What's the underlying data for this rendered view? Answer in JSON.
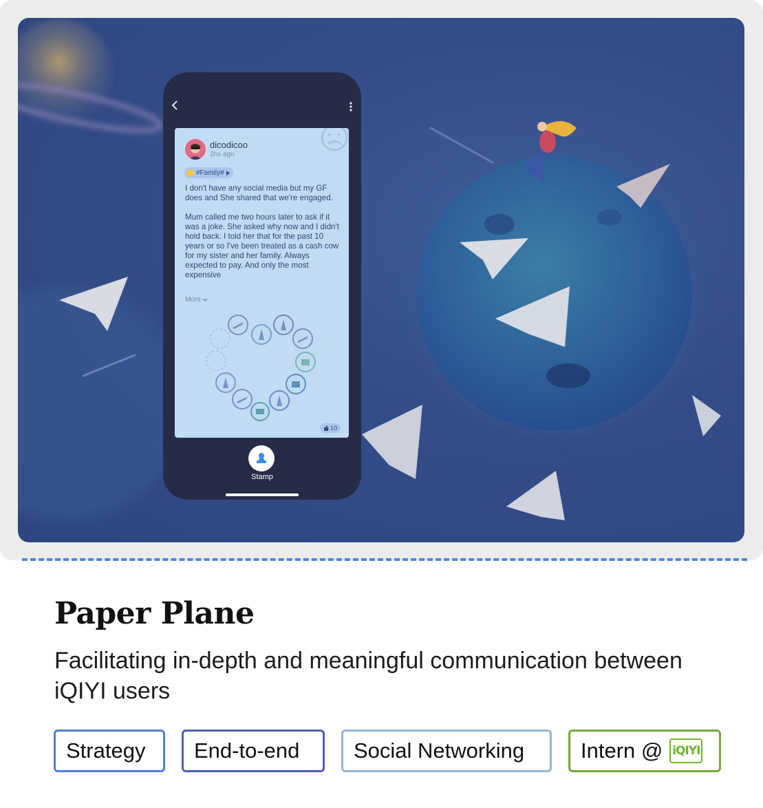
{
  "hero": {
    "post": {
      "username": "dicodicoo",
      "time": "2hs ago",
      "tag": "#Family#",
      "body": "I don't have any social media but my GF does and She shared that we're engaged.\n\nMum called me two hours later to ask if it was a joke. She asked why now and I didn't hold back. I told her that for the past 10 years or so I've been treated as a cash cow for my sister and her family. Always expected to pay. And only the most expensive",
      "more_label": "More",
      "likes": "10"
    },
    "stamp_label": "Stamp"
  },
  "project": {
    "title": "Paper Plane",
    "subtitle": "Facilitating in-depth and meaningful communication between iQIYI users"
  },
  "tags": {
    "strategy": "Strategy",
    "end_to_end": "End-to-end",
    "social": "Social Networking",
    "intern": "Intern @",
    "logo_text": "iQIYI"
  },
  "colors": {
    "hero_bg": "#344d88",
    "accent_dash": "#4f86dd",
    "strategy_border": "#4f7fd8",
    "end_to_end_border": "#4e5fae",
    "social_border": "#8eb6dd",
    "intern_border": "#74a83a",
    "iqiyi_green": "#6fb52c"
  }
}
